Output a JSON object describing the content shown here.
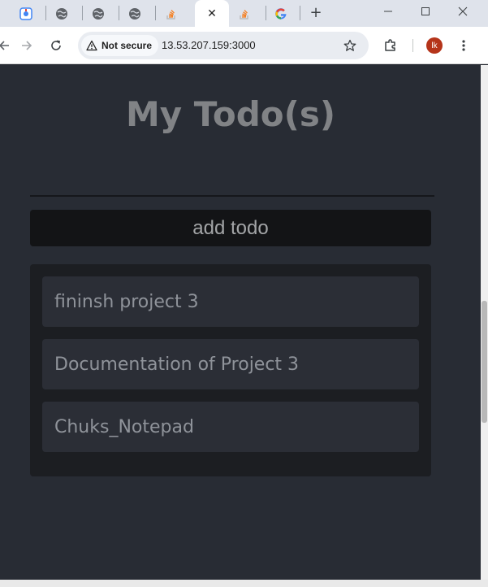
{
  "browser": {
    "security_label": "Not secure",
    "url": "13.53.207.159:3000",
    "profile_initials": "lk",
    "tabs": [
      {
        "icon": "extension-app-icon"
      },
      {
        "icon": "globe-icon"
      },
      {
        "icon": "globe-icon"
      },
      {
        "icon": "globe-icon"
      },
      {
        "icon": "stackoverflow-icon"
      },
      {
        "icon": "close-icon",
        "active": true
      },
      {
        "icon": "stackoverflow-icon"
      },
      {
        "icon": "google-icon"
      }
    ],
    "new_tab_symbol": "+",
    "close_tab_symbol": "✕"
  },
  "app": {
    "title": "My Todo(s)",
    "add_button_label": "add todo",
    "todos": [
      "fininsh project 3",
      "Documentation of Project 3",
      "Chuks_Notepad"
    ]
  },
  "colors": {
    "page_background": "#282c34",
    "title": "#818386",
    "add_button_bg": "#131416",
    "list_bg": "#1c1e22",
    "item_bg": "#2b2e36",
    "item_text": "#8f939a"
  }
}
